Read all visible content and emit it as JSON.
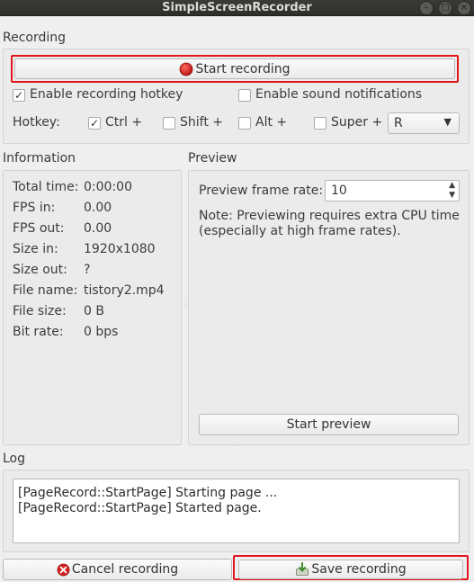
{
  "window": {
    "title": "SimpleScreenRecorder"
  },
  "recording": {
    "section_label": "Recording",
    "start_button": "Start recording",
    "enable_hotkey_label": "Enable recording hotkey",
    "enable_hotkey_checked": true,
    "sound_notifications_label": "Enable sound notifications",
    "sound_notifications_checked": false,
    "hotkey_label": "Hotkey:",
    "ctrl_label": "Ctrl +",
    "ctrl_checked": true,
    "shift_label": "Shift +",
    "shift_checked": false,
    "alt_label": "Alt +",
    "alt_checked": false,
    "super_label": "Super +",
    "super_checked": false,
    "key_value": "R"
  },
  "information": {
    "section_label": "Information",
    "rows": [
      {
        "label": "Total time:",
        "value": "0:00:00"
      },
      {
        "label": "FPS in:",
        "value": "0.00"
      },
      {
        "label": "FPS out:",
        "value": "0.00"
      },
      {
        "label": "Size in:",
        "value": "1920x1080"
      },
      {
        "label": "Size out:",
        "value": "?"
      },
      {
        "label": "File name:",
        "value": "tistory2.mp4"
      },
      {
        "label": "File size:",
        "value": "0 B"
      },
      {
        "label": "Bit rate:",
        "value": "0 bps"
      }
    ]
  },
  "preview": {
    "section_label": "Preview",
    "frame_rate_label": "Preview frame rate:",
    "frame_rate_value": "10",
    "note_line1": "Note: Previewing requires extra CPU time",
    "note_line2": "(especially at high frame rates).",
    "start_button": "Start preview"
  },
  "log": {
    "section_label": "Log",
    "lines": [
      "[PageRecord::StartPage] Starting page ...",
      "[PageRecord::StartPage] Started page."
    ]
  },
  "footer": {
    "cancel_button": "Cancel recording",
    "save_button": "Save recording"
  },
  "colors": {
    "highlight": "#e0161c",
    "record_dot": "#d42020",
    "cancel_icon": "#d42020"
  }
}
